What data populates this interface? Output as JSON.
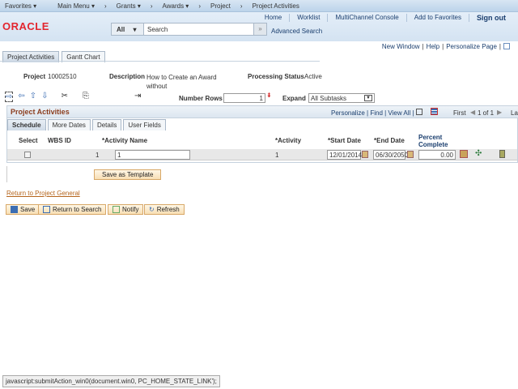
{
  "topnav": {
    "items": [
      "Favorites ▾",
      "Main Menu ▾",
      "›",
      "Grants ▾",
      "›",
      "Awards ▾",
      "›",
      "Project",
      "›",
      "Project Activities"
    ]
  },
  "header": {
    "logo": "ORACLE",
    "links": [
      "Home",
      "Worklist",
      "MultiChannel Console",
      "Add to Favorites"
    ],
    "signout": "Sign out",
    "search": {
      "scope": "All",
      "placeholder": "Search",
      "advanced": "Advanced Search"
    }
  },
  "pagelinks": {
    "new_window": "New Window",
    "help": "Help",
    "personalize": "Personalize Page"
  },
  "tabs": [
    {
      "label": "Project Activities",
      "active": true
    },
    {
      "label": "Gantt Chart",
      "active": false
    }
  ],
  "project": {
    "project_label": "Project",
    "project_value": "10002510",
    "description_label": "Description",
    "description_value": "How to Create an Award without",
    "status_label": "Processing Status",
    "status_value": "Active"
  },
  "toolbar": {
    "number_rows_label": "Number Rows",
    "number_rows_value": "1",
    "expand_label": "Expand",
    "expand_value": "All Subtasks"
  },
  "grid": {
    "title": "Project Activities",
    "links": "Personalize | Find | View All |",
    "nav": {
      "first": "First",
      "count": "1 of 1",
      "last": "La"
    },
    "subtabs": [
      "Schedule",
      "More Dates",
      "Details",
      "User Fields"
    ],
    "columns": [
      "Select",
      "WBS ID",
      "*Activity Name",
      "*Activity",
      "*Start Date",
      "*End Date",
      "Percent Complete"
    ],
    "rows": [
      {
        "wbs": "1",
        "activity_name": "1",
        "activity": "1",
        "start": "12/01/2014",
        "end": "06/30/2050",
        "percent": "0.00",
        "selected": false
      }
    ]
  },
  "save_template": "Save as Template",
  "return_link": "Return to Project General",
  "buttons": {
    "save": "Save",
    "return": "Return to Search",
    "notify": "Notify",
    "refresh": "Refresh"
  },
  "statusbar": "javascript:submitAction_win0(document.win0, PC_HOME_STATE_LINK');"
}
